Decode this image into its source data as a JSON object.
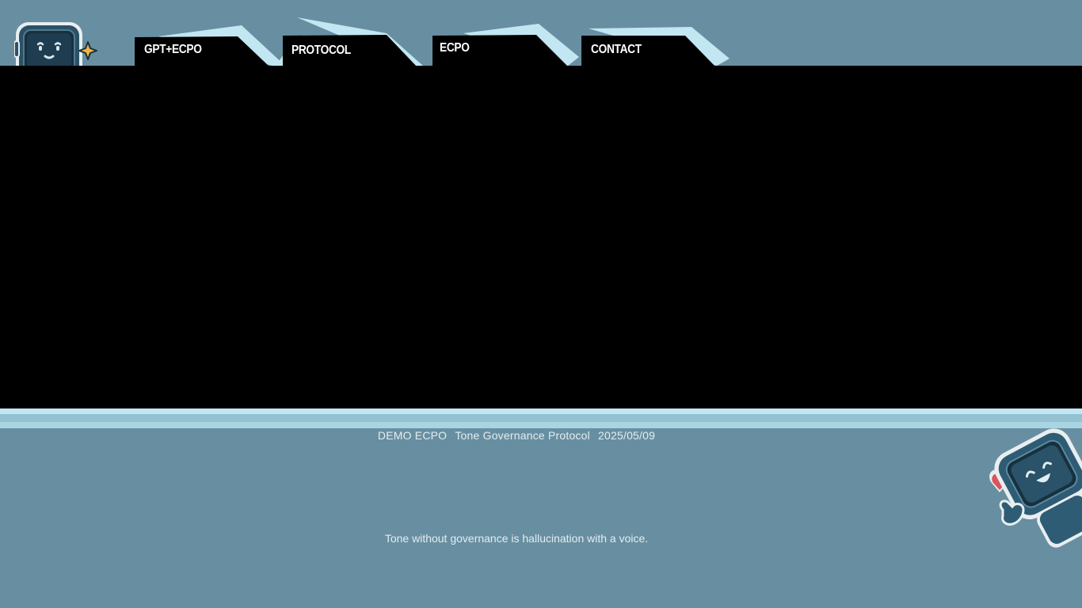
{
  "app": {
    "logo_icon": "robot-mascot-icon",
    "colors": {
      "background": "#688fa1",
      "panel": "#000000",
      "tab_accent": "#c2e6f2",
      "mascot_body": "#35627a",
      "mascot_screen": "#1f3b4d",
      "heart": "#d9545c",
      "star": "#f2b441"
    }
  },
  "nav": {
    "tabs": [
      {
        "label": "GPT+ECPO"
      },
      {
        "label": "PROTOCOL"
      },
      {
        "label": "ECPO"
      },
      {
        "label": "CONTACT"
      }
    ]
  },
  "footer": {
    "brand": "DEMO ECPO",
    "protocol_name": "Tone Governance Protocol",
    "date": "2025/05/09",
    "tagline": "Tone without governance is hallucination with a voice.",
    "mascot_icon": "waving-robot-mascot-icon",
    "heart_icon": "heart-icon"
  }
}
